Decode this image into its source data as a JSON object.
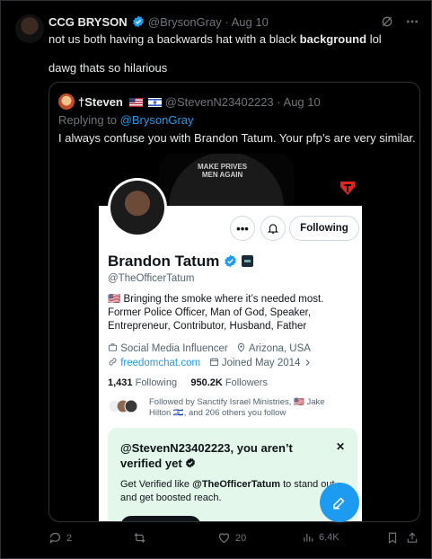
{
  "tweet": {
    "author_name": "CCG BRYSON",
    "author_handle": "@BrysonGray",
    "separator": "·",
    "date": "Aug 10",
    "text_before": "not us both having a backwards hat with a black ",
    "text_bold": "background",
    "text_after": " lol",
    "text_line2": "dawg thats so hilarious"
  },
  "quote": {
    "author_name": "Steven",
    "author_prefix": "†",
    "author_handle": "@StevenN23402223",
    "separator": "·",
    "date": "Aug 10",
    "replying_prefix": "Replying to",
    "replying_handle": "@BrysonGray",
    "text": "I always confuse you with Brandon Tatum. Your pfp’s are very similar."
  },
  "profile": {
    "banner_text_1": "MAKE PRIVES",
    "banner_text_2": "MEN AGAIN",
    "more_label": "•••",
    "following_label": "Following",
    "name": "Brandon Tatum",
    "handle": "@TheOfficerTatum",
    "bio_line1": "🇺🇸 Bringing the smoke where it’s needed most.",
    "bio_line2": "Former Police Officer, Man of God, Speaker,",
    "bio_line3": "Entrepreneur, Contributor, Husband, Father",
    "category": "Social Media Influencer",
    "location": "Arizona, USA",
    "website": "freedomchat.com",
    "joined": "Joined May 2014",
    "following_count": "1,431",
    "following_text": "Following",
    "followers_count": "950.2K",
    "followers_text": "Followers",
    "followed_by_line1": "Followed by Sanctify Israel Ministries, 🇺🇸 Jake",
    "followed_by_line2": "Hilton 🇮🇱, and 206 others you follow",
    "verify_title": "@StevenN23402223, you aren’t verified yet",
    "verify_close": "✕",
    "verify_body_prefix": "Get Verified like ",
    "verify_body_handle": "@TheOfficerTatum",
    "verify_body_suffix": " to stand out and get boosted reach."
  },
  "actions": {
    "replies": "2",
    "retweets": "",
    "likes": "20",
    "views": "6.4K"
  },
  "colors": {
    "accent": "#1d9bf0",
    "background": "#000000",
    "muted": "#71767b",
    "verify_card": "#e3f7ea"
  },
  "icons": [
    "grok-icon",
    "more-icon",
    "reply-icon",
    "retweet-icon",
    "like-icon",
    "views-icon",
    "bookmark-icon",
    "share-icon",
    "compose-icon"
  ]
}
